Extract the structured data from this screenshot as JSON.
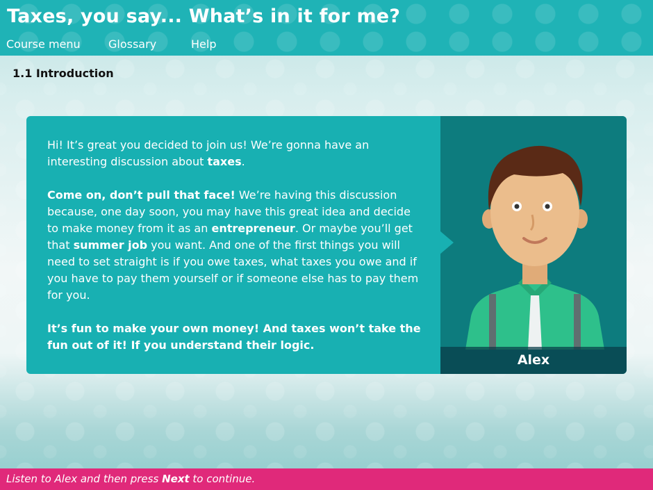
{
  "header": {
    "title": "Taxes, you say... What’s in it for me?",
    "nav": [
      "Course menu",
      "Glossary",
      "Help"
    ]
  },
  "breadcrumb": "1.1 Introduction",
  "dialog": {
    "p1": "Hi! It’s great you decided to join us! We’re gonna have an interesting discussion about ",
    "p1_bold": "taxes",
    "p1_end": ".",
    "p2_bold1": "Come on, don’t pull that face!",
    "p2_a": " We’re having this discussion because, one day soon, you may have this great idea and decide to make money from it as an ",
    "p2_bold2": "entrepreneur",
    "p2_b": ". Or maybe you’ll get that ",
    "p2_bold3": "summer job",
    "p2_c": " you want. And one of the first things you will need to set straight is if you owe taxes, what taxes you owe and if you have to pay them yourself or if someone else has to pay them for you.",
    "p3_bold": "It’s fun to make your own money! And taxes won’t take the fun out of it! If you understand their logic."
  },
  "character": {
    "name": "Alex",
    "icon": "character-portrait"
  },
  "footer": {
    "pre": "Listen to Alex and then press ",
    "bold": "Next",
    "post": " to continue."
  },
  "colors": {
    "teal": "#18b0b2",
    "dark_teal": "#0d7c7e",
    "pink": "#e0297a"
  }
}
